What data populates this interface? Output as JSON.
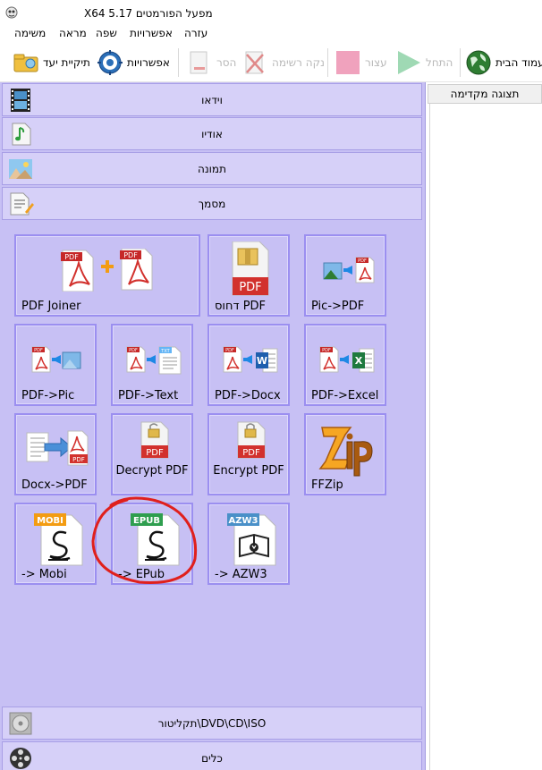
{
  "window": {
    "title": "X64 5.17 מפעל הפורמטים"
  },
  "menu": {
    "items": [
      "משימה",
      "מראה",
      "שפה",
      "אפשרויות",
      "עזרה"
    ]
  },
  "toolbar": {
    "home_label": "עמוד הבית",
    "start_label": "התחל",
    "stop_label": "עצור",
    "remove_label": "נקה רשימה",
    "delete_label": "הסר",
    "options_label": "אפשרויות",
    "output_folder_label": "תיקיית יעד"
  },
  "categories": {
    "video": "וידאו",
    "audio": "אודיו",
    "image": "תמונה",
    "document": "מסמך",
    "rom": "תקליטור\\DVD\\CD\\ISO",
    "tools": "כלים"
  },
  "tiles": {
    "pdf_joiner": "PDF Joiner",
    "pdf_compress": "דחוס PDF",
    "pic_to_pdf": "Pic->PDF",
    "pdf_to_pic": "PDF->Pic",
    "pdf_to_text": "PDF->Text",
    "pdf_to_docx": "PDF->Docx",
    "pdf_to_excel": "PDF->Excel",
    "docx_to_pdf": "Docx->PDF",
    "decrypt_pdf": "Decrypt PDF",
    "encrypt_pdf": "Encrypt PDF",
    "ffzip": "FFZip",
    "to_mobi": "-> Mobi",
    "to_epub": "-> EPub",
    "to_azw3": "-> AZW3"
  },
  "icon_text": {
    "pdf": "PDF",
    "txt": "TXT",
    "mobi": "MOBI",
    "epub": "EPUB",
    "azw3": "AZW3",
    "word": "W",
    "excel": "X"
  },
  "preview": {
    "header": "תצוגה מקדימה"
  },
  "colors": {
    "panel_bg": "#c7c0f4",
    "tile_border": "#9b8ff0",
    "pdf_red": "#d2312d",
    "annotation_red": "#e0201c"
  }
}
